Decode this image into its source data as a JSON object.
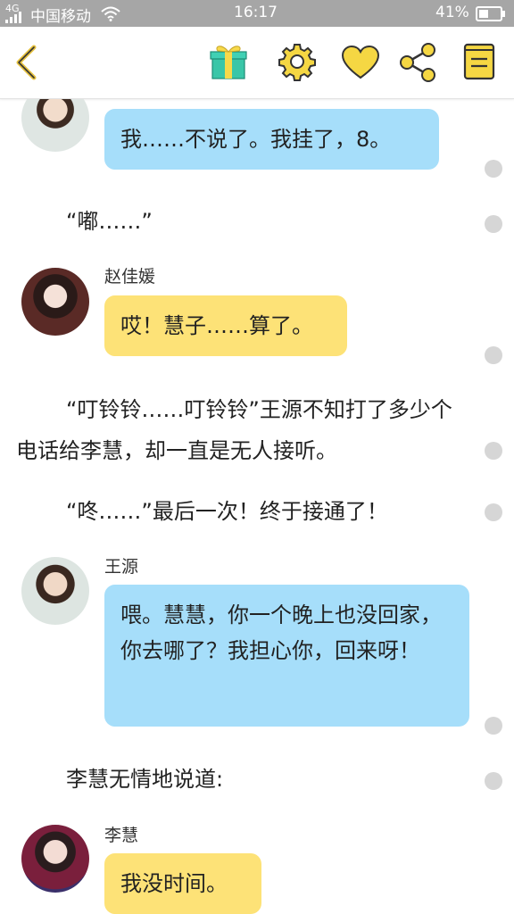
{
  "status_bar": {
    "signal_text": "4G",
    "carrier": "中国移动",
    "time": "16:17",
    "battery": "41%"
  },
  "toolbar": {
    "icons": [
      "back-icon",
      "gift-icon",
      "settings-icon",
      "heart-icon",
      "share-icon",
      "book-icon"
    ]
  },
  "colors": {
    "status_bar": "#a6a6a6",
    "accent": "#fbd84b",
    "bubble_blue": "#a6defa",
    "bubble_yellow": "#fde277"
  },
  "messages": [
    {
      "type": "chat",
      "text": "我……不说了。我挂了，8。"
    },
    {
      "type": "narration",
      "text": "“嘟……”"
    },
    {
      "type": "chat",
      "name": "赵佳媛",
      "text": "哎！慧子……算了。"
    },
    {
      "type": "narration",
      "text": "“叮铃铃……叮铃铃”王源不知打了多少个电话给李慧，却一直是无人接听。"
    },
    {
      "type": "narration",
      "text": "“咚……”最后一次！终于接通了！"
    },
    {
      "type": "chat",
      "name": "王源",
      "text": "喂。慧慧，你一个晚上也没回家，你去哪了？我担心你，回来呀！"
    },
    {
      "type": "narration",
      "text": "李慧无情地说道:"
    },
    {
      "type": "chat",
      "name": "李慧",
      "text": "我没时间。"
    }
  ]
}
